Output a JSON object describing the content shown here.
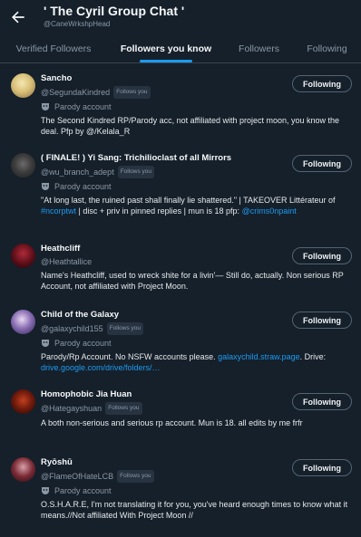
{
  "header": {
    "title": "' The Cyril Group Chat '",
    "subtitle": "@CaneWrkshpHead"
  },
  "tabs": [
    {
      "label": "Verified Followers",
      "active": false
    },
    {
      "label": "Followers you know",
      "active": true
    },
    {
      "label": "Followers",
      "active": false
    },
    {
      "label": "Following",
      "active": false
    }
  ],
  "colors": {
    "background": "#15202b",
    "accent": "#1d9bf0",
    "muted_text": "#8b98a5"
  },
  "users": [
    {
      "name": "Sancho",
      "handle": "@SegundaKindred",
      "badge": "Follows you",
      "parody_label": "Parody account",
      "bio": "The Second Kindred RP/Parody acc, not affiliated with project moon, you know the deal. Pfp by @/Kelala_R",
      "button": "Following"
    },
    {
      "name": "( FINALE! ) Yi Sang: Trichilioclast of all Mirrors",
      "handle": "@wu_branch_adept",
      "badge": "Follows you",
      "parody_label": "Parody account",
      "bio_parts": {
        "a": "\"At long last, the ruined past shall finally lie shattered.\" | TAKEOVER Littérateur of ",
        "hashtag": "#ncorptwt",
        "b": " | disc + priv in pinned replies | mun is 18 pfp: ",
        "mention": "@crims0npaint"
      },
      "button": "Following"
    },
    {
      "name": "Heathcliff",
      "handle": "@Heathtallice",
      "bio": "Name's Heathcliff, used to wreck shite for a livin'— Still do, actually. Non serious RP Account, not affiliated with Project Moon.",
      "button": "Following"
    },
    {
      "name": "Child of the Galaxy",
      "handle": "@galaxychild155",
      "badge": "Follows you",
      "parody_label": "Parody account",
      "bio_parts": {
        "a": "Parody/Rp Account. No NSFW accounts please. ",
        "link1": "galaxychild.straw.page",
        "b": ". Drive: ",
        "link2": "drive.google.com/drive/folders/…"
      },
      "button": "Following"
    },
    {
      "name": "Homophobic Jia Huan",
      "handle": "@Hategayshuan",
      "badge": "Follows you",
      "bio": "A both non-serious and serious rp account. Mun is 18. all edits by me frfr",
      "button": "Following"
    },
    {
      "name": "Ryōshū",
      "handle": "@FlameOfHateLCB",
      "badge": "Follows you",
      "parody_label": "Parody account",
      "bio": "O.S.H.A.R.E, I'm not translating it for you, you've heard enough times to know what it means.//Not affiliated With Project Moon //",
      "button": "Following"
    }
  ]
}
